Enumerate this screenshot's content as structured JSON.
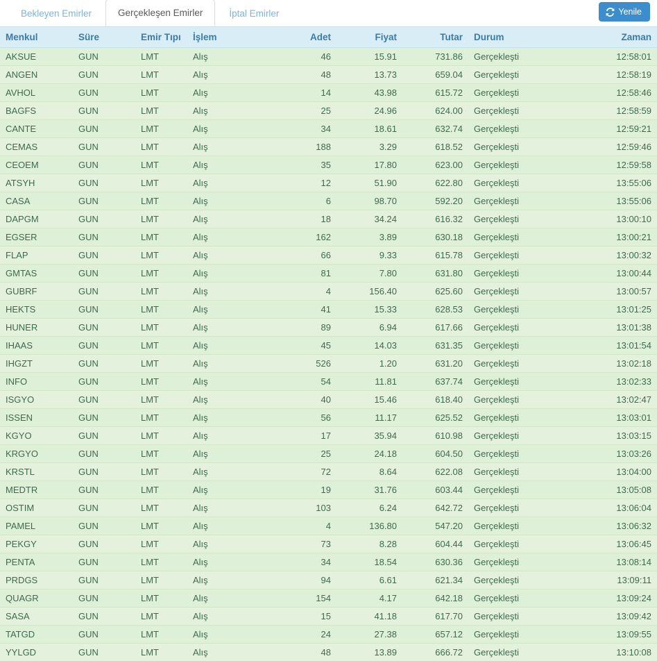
{
  "tabs": [
    {
      "label": "Bekleyen Emirler",
      "active": false
    },
    {
      "label": "Gerçekleşen Emirler",
      "active": true
    },
    {
      "label": "İptal Emirler",
      "active": false
    }
  ],
  "toolbar": {
    "refresh_label": "Yenile",
    "refresh_icon": "refresh-icon",
    "refresh_color": "#3c8dcd"
  },
  "colors": {
    "header_bg": "#d9edf7",
    "header_text": "#3a7ca5",
    "row_bg": "#dff0d8",
    "row_alt_bg": "#e4f2dd",
    "row_text": "#3c6a50",
    "symbol_text": "#2f7392",
    "tab_link": "#7bb3dd"
  },
  "table": {
    "columns": [
      {
        "key": "menkul",
        "label": "Menkul",
        "align": "left"
      },
      {
        "key": "sure",
        "label": "Süre",
        "align": "left"
      },
      {
        "key": "tip",
        "label": "Emir Tıpı",
        "align": "left"
      },
      {
        "key": "islem",
        "label": "İşlem",
        "align": "left"
      },
      {
        "key": "adet",
        "label": "Adet",
        "align": "right"
      },
      {
        "key": "fiyat",
        "label": "Fiyat",
        "align": "right"
      },
      {
        "key": "tutar",
        "label": "Tutar",
        "align": "right"
      },
      {
        "key": "durum",
        "label": "Durum",
        "align": "left"
      },
      {
        "key": "zaman",
        "label": "Zaman",
        "align": "right"
      }
    ],
    "rows": [
      {
        "menkul": "AKSUE",
        "sure": "GUN",
        "tip": "LMT",
        "islem": "Alış",
        "adet": "46",
        "fiyat": "15.91",
        "tutar": "731.86",
        "durum": "Gerçekleşti",
        "zaman": "12:58:01"
      },
      {
        "menkul": "ANGEN",
        "sure": "GUN",
        "tip": "LMT",
        "islem": "Alış",
        "adet": "48",
        "fiyat": "13.73",
        "tutar": "659.04",
        "durum": "Gerçekleşti",
        "zaman": "12:58:19"
      },
      {
        "menkul": "AVHOL",
        "sure": "GUN",
        "tip": "LMT",
        "islem": "Alış",
        "adet": "14",
        "fiyat": "43.98",
        "tutar": "615.72",
        "durum": "Gerçekleşti",
        "zaman": "12:58:46"
      },
      {
        "menkul": "BAGFS",
        "sure": "GUN",
        "tip": "LMT",
        "islem": "Alış",
        "adet": "25",
        "fiyat": "24.96",
        "tutar": "624.00",
        "durum": "Gerçekleşti",
        "zaman": "12:58:59"
      },
      {
        "menkul": "CANTE",
        "sure": "GUN",
        "tip": "LMT",
        "islem": "Alış",
        "adet": "34",
        "fiyat": "18.61",
        "tutar": "632.74",
        "durum": "Gerçekleşti",
        "zaman": "12:59:21"
      },
      {
        "menkul": "CEMAS",
        "sure": "GUN",
        "tip": "LMT",
        "islem": "Alış",
        "adet": "188",
        "fiyat": "3.29",
        "tutar": "618.52",
        "durum": "Gerçekleşti",
        "zaman": "12:59:46"
      },
      {
        "menkul": "CEOEM",
        "sure": "GUN",
        "tip": "LMT",
        "islem": "Alış",
        "adet": "35",
        "fiyat": "17.80",
        "tutar": "623.00",
        "durum": "Gerçekleşti",
        "zaman": "12:59:58"
      },
      {
        "menkul": "ATSYH",
        "sure": "GUN",
        "tip": "LMT",
        "islem": "Alış",
        "adet": "12",
        "fiyat": "51.90",
        "tutar": "622.80",
        "durum": "Gerçekleşti",
        "zaman": "13:55:06"
      },
      {
        "menkul": "CASA",
        "sure": "GUN",
        "tip": "LMT",
        "islem": "Alış",
        "adet": "6",
        "fiyat": "98.70",
        "tutar": "592.20",
        "durum": "Gerçekleşti",
        "zaman": "13:55:06"
      },
      {
        "menkul": "DAPGM",
        "sure": "GUN",
        "tip": "LMT",
        "islem": "Alış",
        "adet": "18",
        "fiyat": "34.24",
        "tutar": "616.32",
        "durum": "Gerçekleşti",
        "zaman": "13:00:10"
      },
      {
        "menkul": "EGSER",
        "sure": "GUN",
        "tip": "LMT",
        "islem": "Alış",
        "adet": "162",
        "fiyat": "3.89",
        "tutar": "630.18",
        "durum": "Gerçekleşti",
        "zaman": "13:00:21"
      },
      {
        "menkul": "FLAP",
        "sure": "GUN",
        "tip": "LMT",
        "islem": "Alış",
        "adet": "66",
        "fiyat": "9.33",
        "tutar": "615.78",
        "durum": "Gerçekleşti",
        "zaman": "13:00:32"
      },
      {
        "menkul": "GMTAS",
        "sure": "GUN",
        "tip": "LMT",
        "islem": "Alış",
        "adet": "81",
        "fiyat": "7.80",
        "tutar": "631.80",
        "durum": "Gerçekleşti",
        "zaman": "13:00:44"
      },
      {
        "menkul": "GUBRF",
        "sure": "GUN",
        "tip": "LMT",
        "islem": "Alış",
        "adet": "4",
        "fiyat": "156.40",
        "tutar": "625.60",
        "durum": "Gerçekleşti",
        "zaman": "13:00:57"
      },
      {
        "menkul": "HEKTS",
        "sure": "GUN",
        "tip": "LMT",
        "islem": "Alış",
        "adet": "41",
        "fiyat": "15.33",
        "tutar": "628.53",
        "durum": "Gerçekleşti",
        "zaman": "13:01:25"
      },
      {
        "menkul": "HUNER",
        "sure": "GUN",
        "tip": "LMT",
        "islem": "Alış",
        "adet": "89",
        "fiyat": "6.94",
        "tutar": "617.66",
        "durum": "Gerçekleşti",
        "zaman": "13:01:38"
      },
      {
        "menkul": "IHAAS",
        "sure": "GUN",
        "tip": "LMT",
        "islem": "Alış",
        "adet": "45",
        "fiyat": "14.03",
        "tutar": "631.35",
        "durum": "Gerçekleşti",
        "zaman": "13:01:54"
      },
      {
        "menkul": "IHGZT",
        "sure": "GUN",
        "tip": "LMT",
        "islem": "Alış",
        "adet": "526",
        "fiyat": "1.20",
        "tutar": "631.20",
        "durum": "Gerçekleşti",
        "zaman": "13:02:18"
      },
      {
        "menkul": "INFO",
        "sure": "GUN",
        "tip": "LMT",
        "islem": "Alış",
        "adet": "54",
        "fiyat": "11.81",
        "tutar": "637.74",
        "durum": "Gerçekleşti",
        "zaman": "13:02:33"
      },
      {
        "menkul": "ISGYO",
        "sure": "GUN",
        "tip": "LMT",
        "islem": "Alış",
        "adet": "40",
        "fiyat": "15.46",
        "tutar": "618.40",
        "durum": "Gerçekleşti",
        "zaman": "13:02:47"
      },
      {
        "menkul": "ISSEN",
        "sure": "GUN",
        "tip": "LMT",
        "islem": "Alış",
        "adet": "56",
        "fiyat": "11.17",
        "tutar": "625.52",
        "durum": "Gerçekleşti",
        "zaman": "13:03:01"
      },
      {
        "menkul": "KGYO",
        "sure": "GUN",
        "tip": "LMT",
        "islem": "Alış",
        "adet": "17",
        "fiyat": "35.94",
        "tutar": "610.98",
        "durum": "Gerçekleşti",
        "zaman": "13:03:15"
      },
      {
        "menkul": "KRGYO",
        "sure": "GUN",
        "tip": "LMT",
        "islem": "Alış",
        "adet": "25",
        "fiyat": "24.18",
        "tutar": "604.50",
        "durum": "Gerçekleşti",
        "zaman": "13:03:26"
      },
      {
        "menkul": "KRSTL",
        "sure": "GUN",
        "tip": "LMT",
        "islem": "Alış",
        "adet": "72",
        "fiyat": "8.64",
        "tutar": "622.08",
        "durum": "Gerçekleşti",
        "zaman": "13:04:00"
      },
      {
        "menkul": "MEDTR",
        "sure": "GUN",
        "tip": "LMT",
        "islem": "Alış",
        "adet": "19",
        "fiyat": "31.76",
        "tutar": "603.44",
        "durum": "Gerçekleşti",
        "zaman": "13:05:08"
      },
      {
        "menkul": "OSTIM",
        "sure": "GUN",
        "tip": "LMT",
        "islem": "Alış",
        "adet": "103",
        "fiyat": "6.24",
        "tutar": "642.72",
        "durum": "Gerçekleşti",
        "zaman": "13:06:04"
      },
      {
        "menkul": "PAMEL",
        "sure": "GUN",
        "tip": "LMT",
        "islem": "Alış",
        "adet": "4",
        "fiyat": "136.80",
        "tutar": "547.20",
        "durum": "Gerçekleşti",
        "zaman": "13:06:32"
      },
      {
        "menkul": "PEKGY",
        "sure": "GUN",
        "tip": "LMT",
        "islem": "Alış",
        "adet": "73",
        "fiyat": "8.28",
        "tutar": "604.44",
        "durum": "Gerçekleşti",
        "zaman": "13:06:45"
      },
      {
        "menkul": "PENTA",
        "sure": "GUN",
        "tip": "LMT",
        "islem": "Alış",
        "adet": "34",
        "fiyat": "18.54",
        "tutar": "630.36",
        "durum": "Gerçekleşti",
        "zaman": "13:08:14"
      },
      {
        "menkul": "PRDGS",
        "sure": "GUN",
        "tip": "LMT",
        "islem": "Alış",
        "adet": "94",
        "fiyat": "6.61",
        "tutar": "621.34",
        "durum": "Gerçekleşti",
        "zaman": "13:09:11"
      },
      {
        "menkul": "QUAGR",
        "sure": "GUN",
        "tip": "LMT",
        "islem": "Alış",
        "adet": "154",
        "fiyat": "4.17",
        "tutar": "642.18",
        "durum": "Gerçekleşti",
        "zaman": "13:09:24"
      },
      {
        "menkul": "SASA",
        "sure": "GUN",
        "tip": "LMT",
        "islem": "Alış",
        "adet": "15",
        "fiyat": "41.18",
        "tutar": "617.70",
        "durum": "Gerçekleşti",
        "zaman": "13:09:42"
      },
      {
        "menkul": "TATGD",
        "sure": "GUN",
        "tip": "LMT",
        "islem": "Alış",
        "adet": "24",
        "fiyat": "27.38",
        "tutar": "657.12",
        "durum": "Gerçekleşti",
        "zaman": "13:09:55"
      },
      {
        "menkul": "YYLGD",
        "sure": "GUN",
        "tip": "LMT",
        "islem": "Alış",
        "adet": "48",
        "fiyat": "13.89",
        "tutar": "666.72",
        "durum": "Gerçekleşti",
        "zaman": "13:10:08"
      }
    ]
  }
}
